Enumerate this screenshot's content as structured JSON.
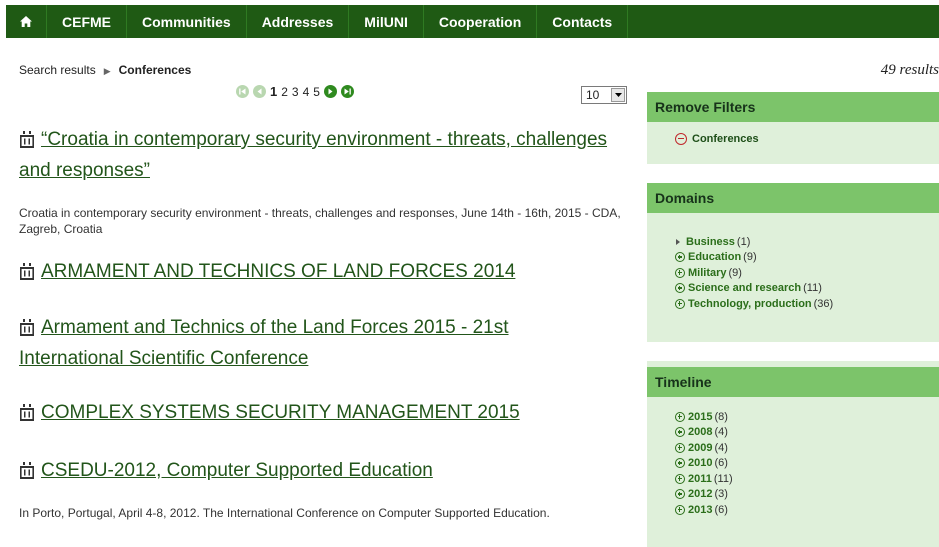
{
  "nav": {
    "home_icon": "home-icon",
    "items": [
      "CEFME",
      "Communities",
      "Addresses",
      "MilUNI",
      "Cooperation",
      "Contacts"
    ]
  },
  "breadcrumb": {
    "parent": "Search results",
    "current": "Conferences"
  },
  "results_count": "49 results",
  "pager": {
    "pages": [
      "1",
      "2",
      "3",
      "4",
      "5"
    ],
    "current_page": "1",
    "per_page": "10"
  },
  "results": [
    {
      "title_line1": "“Croatia in contemporary security environment - threats, challenges",
      "title_line2": "and responses”",
      "description": "Croatia in contemporary security environment - threats, challenges and responses, June 14th - 16th, 2015 - CDA, Zagreb, Croatia"
    },
    {
      "title_line1": "ARMAMENT AND TECHNICS OF LAND FORCES 2014"
    },
    {
      "title_line1": "Armament and Technics of the Land Forces 2015 - 21st",
      "title_line2": "International Scientific Conference"
    },
    {
      "title_line1": "COMPLEX SYSTEMS SECURITY MANAGEMENT 2015"
    },
    {
      "title_line1": "CSEDU-2012, Computer Supported Education",
      "description": "In Porto, Portugal, April 4-8, 2012. The International Conference on Computer Supported Education."
    }
  ],
  "sidebar": {
    "remove_filters": {
      "header": "Remove Filters",
      "items": [
        {
          "label": "Conferences"
        }
      ]
    },
    "domains": {
      "header": "Domains",
      "items": [
        {
          "label": "Business",
          "count": "(1)"
        },
        {
          "label": "Education",
          "count": "(9)"
        },
        {
          "label": "Military",
          "count": "(9)"
        },
        {
          "label": "Science and research",
          "count": "(11)"
        },
        {
          "label": "Technology, production",
          "count": "(36)"
        }
      ]
    },
    "timeline": {
      "header": "Timeline",
      "items": [
        {
          "label": "2015",
          "count": "(8)"
        },
        {
          "label": "2008",
          "count": "(4)"
        },
        {
          "label": "2009",
          "count": "(4)"
        },
        {
          "label": "2010",
          "count": "(6)"
        },
        {
          "label": "2011",
          "count": "(11)"
        },
        {
          "label": "2012",
          "count": "(3)"
        },
        {
          "label": "2013",
          "count": "(6)"
        }
      ]
    }
  },
  "colors": {
    "nav_bg": "#1f5a14",
    "accent_green": "#7cc46a",
    "panel_bg": "#dff0da",
    "link": "#22551a",
    "remove": "#c0282c"
  }
}
